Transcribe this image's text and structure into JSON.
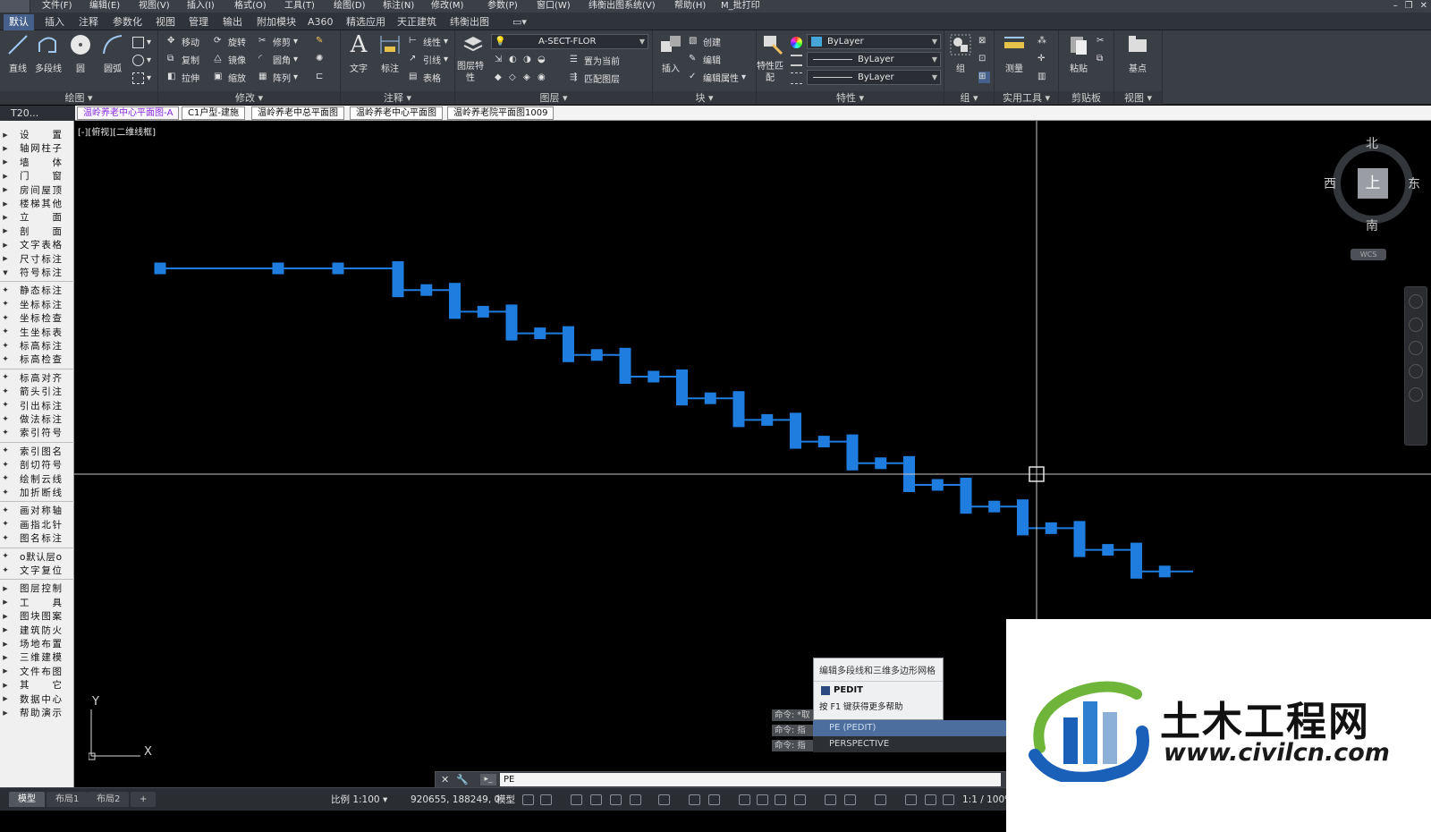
{
  "menubar": {
    "items": [
      "文件(F)",
      "编辑(E)",
      "视图(V)",
      "插入(I)",
      "格式(O)",
      "工具(T)",
      "绘图(D)",
      "标注(N)",
      "修改(M)",
      "参数(P)",
      "窗口(W)",
      "纬衡出图系统(V)",
      "帮助(H)",
      "M_批打印"
    ]
  },
  "ribbon_tabs": [
    "默认",
    "插入",
    "注释",
    "参数化",
    "视图",
    "管理",
    "输出",
    "附加模块",
    "A360",
    "精选应用",
    "天正建筑",
    "纬衡出图"
  ],
  "ribbon": {
    "draw": {
      "title": "绘图",
      "line": "直线",
      "polyline": "多段线",
      "circle": "圆",
      "arc": "圆弧"
    },
    "modify": {
      "title": "修改",
      "move": "移动",
      "rotate": "旋转",
      "trim": "修剪",
      "copy": "复制",
      "mirror": "镜像",
      "fillet": "圆角",
      "stretch": "拉伸",
      "scale": "缩放",
      "array": "阵列"
    },
    "annotation": {
      "title": "注释",
      "text": "文字",
      "dimension": "标注",
      "linear": "线性",
      "leader": "引线",
      "table": "表格"
    },
    "layers": {
      "title": "图层",
      "layer_props": "图层特性",
      "layer_name": "A-SECT-FLOR",
      "set_current": "置为当前",
      "match_layer": "匹配图层"
    },
    "block": {
      "title": "块",
      "insert": "插入",
      "create": "创建",
      "edit": "编辑",
      "edit_attr": "编辑属性"
    },
    "properties": {
      "title": "特性",
      "match": "特性匹配",
      "color": "ByLayer",
      "linetype": "ByLayer",
      "lineweight": "ByLayer"
    },
    "group": {
      "title": "组",
      "group": "组"
    },
    "utilities": {
      "title": "实用工具",
      "measure": "测量"
    },
    "clipboard": {
      "title": "剪贴板",
      "paste": "粘贴"
    },
    "view": {
      "title": "视图",
      "basepoint": "基点"
    }
  },
  "doc_tabs": {
    "t20": "T20...",
    "tabs": [
      "温岭养老中心平面图-A",
      "C1户型-建施",
      "温岭养老中总平面图",
      "温岭养老中心平面图",
      "温岭养老院平面图1009"
    ]
  },
  "palette": {
    "items": [
      "设　置",
      "轴网柱子",
      "墙　体",
      "门　窗",
      "房间屋顶",
      "楼梯其他",
      "立　面",
      "剖　面",
      "文字表格",
      "尺寸标注",
      "符号标注",
      "静态标注",
      "坐标标注",
      "坐标检查",
      "生坐标表",
      "标高标注",
      "标高检查",
      "标高对齐",
      "箭头引注",
      "引出标注",
      "做法标注",
      "索引符号",
      "索引图名",
      "剖切符号",
      "绘制云线",
      "加折断线",
      "画对称轴",
      "画指北针",
      "图名标注",
      "o默认层o",
      "文字复位",
      "图层控制",
      "工　具",
      "图块图案",
      "建筑防火",
      "场地布置",
      "三维建模",
      "文件布图",
      "其　它",
      "数据中心",
      "帮助演示"
    ]
  },
  "canvas": {
    "viewport_label": "[-][俯视][二维线框]",
    "viewcube": {
      "north": "北",
      "south": "南",
      "west": "西",
      "east": "东",
      "top": "上",
      "wcs": "WCS"
    },
    "ucs_x": "X",
    "ucs_y": "Y"
  },
  "command": {
    "history": [
      "命令: *取",
      "命令: 指",
      "命令: 指"
    ],
    "autocomplete_title": "编辑多段线和三维多边形网格",
    "autocomplete_cmd": "PEDIT",
    "autocomplete_help": "按 F1 键获得更多帮助",
    "suggestion_1": "PE (PEDIT)",
    "suggestion_2": "PERSPECTIVE",
    "input_value": "PE"
  },
  "statusbar": {
    "layout_tabs": [
      "模型",
      "布局1",
      "布局2"
    ],
    "add_tab": "+",
    "scale": "比例 1:100",
    "coords": "920655, 188249, 0",
    "model": "模型",
    "zoom": "1:1 / 100%"
  },
  "watermark": {
    "name": "土木工程网",
    "url": "www.civilcn.com"
  },
  "colors": {
    "accent": "#45608a",
    "drawing_line": "#1e7ddf",
    "background": "#000000"
  }
}
